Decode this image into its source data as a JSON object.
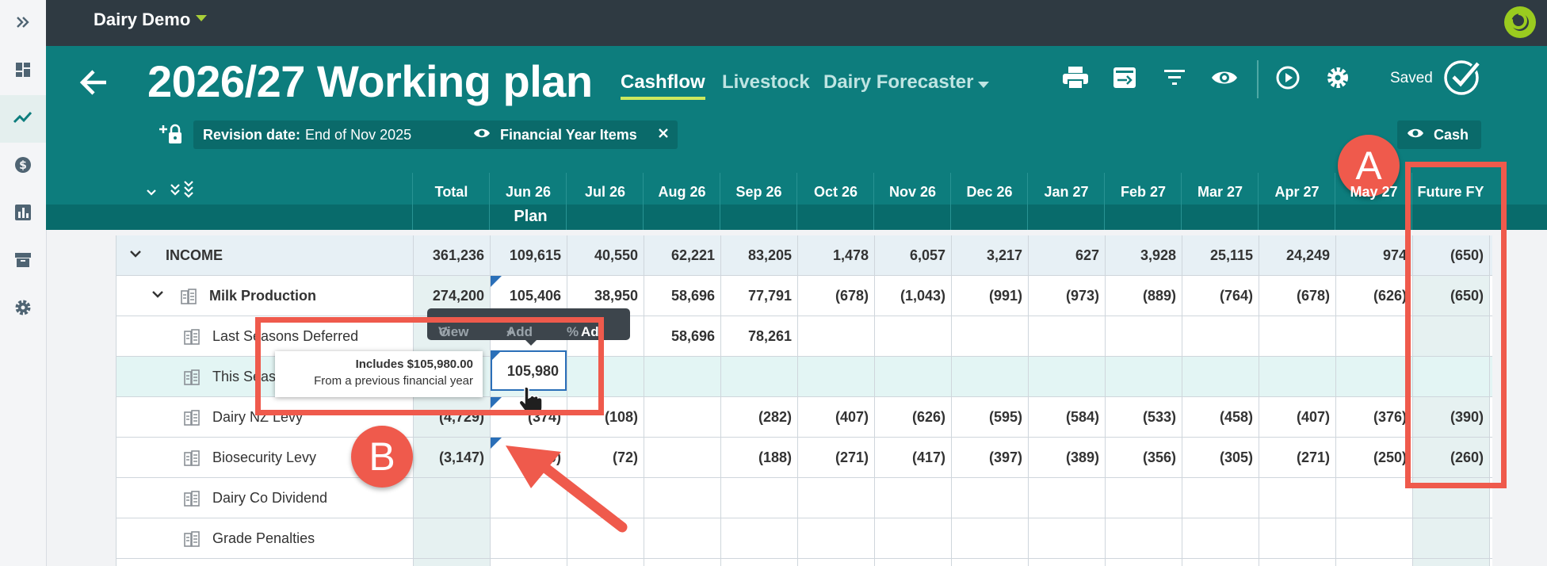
{
  "app": {
    "company_name": "Dairy Demo",
    "brand_color": "#0d7d7d",
    "accent_color": "#cde85e",
    "annotation_color": "#ef5a4c"
  },
  "sidebar": {
    "items": [
      {
        "icon": "chevrons-right-icon",
        "active": false
      },
      {
        "icon": "dashboard-icon",
        "active": false
      },
      {
        "icon": "trend-line-icon",
        "active": true
      },
      {
        "icon": "dollar-icon",
        "active": false
      },
      {
        "icon": "bar-chart-icon",
        "active": false
      },
      {
        "icon": "archive-icon",
        "active": false
      },
      {
        "icon": "gear-icon",
        "active": false
      }
    ]
  },
  "header": {
    "title": "2026/27 Working plan",
    "tabs": [
      {
        "label": "Cashflow",
        "active": true
      },
      {
        "label": "Livestock",
        "active": false
      },
      {
        "label": "Dairy Forecaster",
        "active": false
      }
    ],
    "toolbar_icons": [
      "print-icon",
      "export-icon",
      "filter-icon",
      "view-icon",
      "play-icon",
      "gear-icon"
    ],
    "saved_label": "Saved"
  },
  "filters": {
    "revision_label": "Revision date:",
    "revision_value": "End of Nov 2025",
    "items_chip": "Financial Year Items",
    "cash_chip": "Cash"
  },
  "grid": {
    "columns": [
      "Total",
      "Jun 26",
      "Jul 26",
      "Aug 26",
      "Sep 26",
      "Oct 26",
      "Nov 26",
      "Dec 26",
      "Jan 27",
      "Feb 27",
      "Mar 27",
      "Apr 27",
      "May 27",
      "Future FY"
    ],
    "plan_label": "Plan",
    "rows": [
      {
        "label": "INCOME",
        "type": "section",
        "values": [
          "361,236",
          "109,615",
          "40,550",
          "62,221",
          "83,205",
          "1,478",
          "6,057",
          "3,217",
          "627",
          "3,928",
          "25,115",
          "24,249",
          "974",
          "(650)"
        ]
      },
      {
        "label": "Milk Production",
        "type": "group",
        "values": [
          "274,200",
          "105,406",
          "38,950",
          "58,696",
          "77,791",
          "(678)",
          "(1,043)",
          "(991)",
          "(973)",
          "(889)",
          "(764)",
          "(678)",
          "(626)",
          "(650)"
        ]
      },
      {
        "label": "Last Seasons Deferred",
        "type": "item",
        "values": [
          "",
          "",
          "",
          "58,696",
          "78,261",
          "",
          "",
          "",
          "",
          "",
          "",
          "",
          "",
          ""
        ]
      },
      {
        "label": "This Season",
        "type": "item",
        "values": [
          "",
          "105,980",
          "",
          "",
          "",
          "",
          "",
          "",
          "",
          "",
          "",
          "",
          "",
          ""
        ]
      },
      {
        "label": "Dairy NZ Levy",
        "type": "item",
        "values": [
          "(4,729)",
          "(374)",
          "(108)",
          "",
          "(282)",
          "(407)",
          "(626)",
          "(595)",
          "(584)",
          "(533)",
          "(458)",
          "(407)",
          "(376)",
          "(390)"
        ]
      },
      {
        "label": "Biosecurity Levy",
        "type": "item",
        "values": [
          "(3,147)",
          "(230)",
          "(72)",
          "",
          "(188)",
          "(271)",
          "(417)",
          "(397)",
          "(389)",
          "(356)",
          "(305)",
          "(271)",
          "(250)",
          "(260)"
        ]
      },
      {
        "label": "Dairy Co Dividend",
        "type": "item",
        "values": []
      },
      {
        "label": "Grade Penalties",
        "type": "item",
        "values": []
      }
    ]
  },
  "cell_toolbar": {
    "view": "View",
    "add": "Add",
    "adj": "Adj"
  },
  "tooltip": {
    "line1": "Includes $105,980.00",
    "line2": "From a previous financial year"
  },
  "selected_cell_value": "105,980",
  "annotations": {
    "a": "A",
    "b": "B"
  }
}
